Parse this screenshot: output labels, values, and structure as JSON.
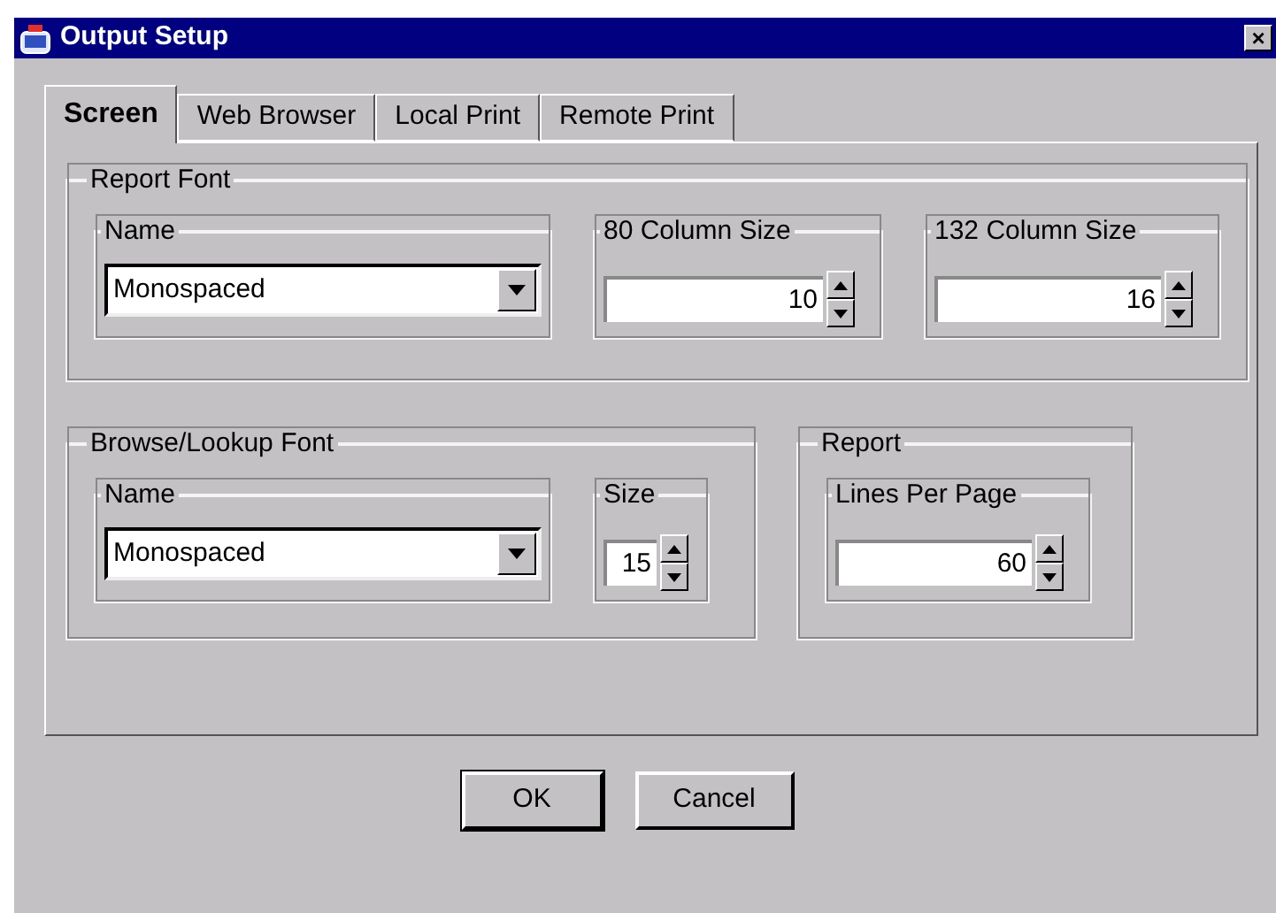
{
  "window": {
    "title": "Output Setup",
    "close": "×"
  },
  "tabs": [
    {
      "label": "Screen",
      "selected": true
    },
    {
      "label": "Web Browser",
      "selected": false
    },
    {
      "label": "Local Print",
      "selected": false
    },
    {
      "label": "Remote Print",
      "selected": false
    }
  ],
  "groups": [
    {
      "title": "Report Font",
      "fields": [
        {
          "kind": "combo",
          "label": "Name",
          "value": "Monospaced"
        },
        {
          "kind": "spinner",
          "label": "80 Column Size",
          "value": "10"
        },
        {
          "kind": "spinner",
          "label": "132 Column Size",
          "value": "16"
        }
      ]
    },
    {
      "title": "Browse/Lookup Font",
      "fields": [
        {
          "kind": "combo",
          "label": "Name",
          "value": "Monospaced"
        },
        {
          "kind": "spinner",
          "label": "Size",
          "value": "15"
        }
      ]
    },
    {
      "title": "Report",
      "fields": [
        {
          "kind": "spinner",
          "label": "Lines Per Page",
          "value": "60"
        }
      ]
    }
  ],
  "buttons": [
    "OK",
    "Cancel"
  ]
}
